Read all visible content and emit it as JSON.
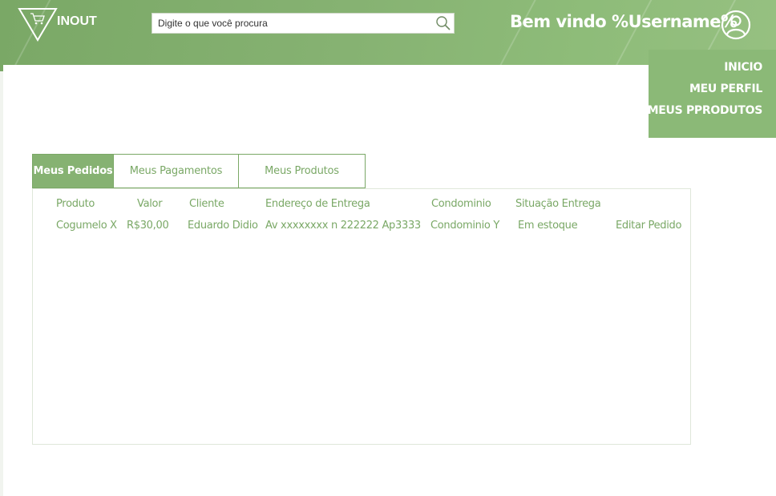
{
  "header": {
    "logo_text": "INOUT",
    "search": {
      "placeholder": "Digite o que você procura"
    },
    "welcome": "Bem vindo %Username%"
  },
  "menu": {
    "items": [
      {
        "label": "INICIO"
      },
      {
        "label": "MEU PERFIL"
      },
      {
        "label": "MEUS PPRODUTOS"
      }
    ]
  },
  "tabs": [
    {
      "label": "Meus Pedidos",
      "active": true
    },
    {
      "label": "Meus Pagamentos",
      "active": false
    },
    {
      "label": "Meus Produtos",
      "active": false
    }
  ],
  "table": {
    "columns": [
      "Produto",
      "Valor",
      "Cliente",
      "Endereço de Entrega",
      "Condominio",
      "Situação Entrega"
    ],
    "rows": [
      {
        "cells": [
          "Cogumelo X",
          "R$30,00",
          "Eduardo Didio",
          "Av xxxxxxxx n 222222 Ap3333",
          "Condominio Y",
          "Em estoque"
        ],
        "action": "Editar Pedido"
      }
    ]
  },
  "colors": {
    "accent": "#86b272",
    "text_accent": "#7aa866",
    "header": "#7aa866"
  },
  "icons": [
    "cart-triangle-logo-icon",
    "search-icon",
    "user-avatar-icon"
  ]
}
